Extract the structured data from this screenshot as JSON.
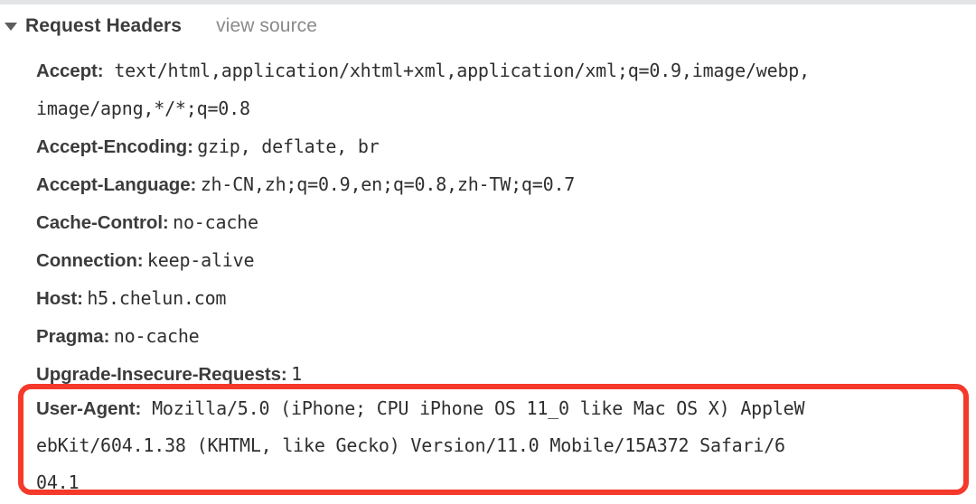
{
  "section": {
    "title": "Request Headers",
    "view_source_label": "view source",
    "disclosure_icon": "triangle-down-icon",
    "expanded": true
  },
  "colors": {
    "highlight_red": "#f5392a",
    "header_name_text": "#3c3c3c",
    "header_value_text": "#2f2f2f",
    "view_source_text": "#8a8a8a",
    "top_strip": "#e3e4e6",
    "background": "#ffffff"
  },
  "headers": [
    {
      "name": "Accept:",
      "value": "text/html,application/xhtml+xml,application/xml;q=0.9,image/webp,image/apng,*/*;q=0.8",
      "lines": [
        "text/html,application/xhtml+xml,application/xml;q=0.9,image/webp,",
        "image/apng,*/*;q=0.8"
      ],
      "highlighted": false
    },
    {
      "name": "Accept-Encoding:",
      "value": "gzip, deflate, br",
      "lines": [
        "gzip, deflate, br"
      ],
      "highlighted": false
    },
    {
      "name": "Accept-Language:",
      "value": "zh-CN,zh;q=0.9,en;q=0.8,zh-TW;q=0.7",
      "lines": [
        "zh-CN,zh;q=0.9,en;q=0.8,zh-TW;q=0.7"
      ],
      "highlighted": false
    },
    {
      "name": "Cache-Control:",
      "value": "no-cache",
      "lines": [
        "no-cache"
      ],
      "highlighted": false
    },
    {
      "name": "Connection:",
      "value": "keep-alive",
      "lines": [
        "keep-alive"
      ],
      "highlighted": false
    },
    {
      "name": "Host:",
      "value": "h5.chelun.com",
      "lines": [
        "h5.chelun.com"
      ],
      "highlighted": false
    },
    {
      "name": "Pragma:",
      "value": "no-cache",
      "lines": [
        "no-cache"
      ],
      "highlighted": false
    },
    {
      "name": "Upgrade-Insecure-Requests:",
      "value": "1",
      "lines": [
        "1"
      ],
      "highlighted": false
    },
    {
      "name": "User-Agent:",
      "value": "Mozilla/5.0 (iPhone; CPU iPhone OS 11_0 like Mac OS X) AppleWebKit/604.1.38 (KHTML, like Gecko) Version/11.0 Mobile/15A372 Safari/604.1",
      "lines": [
        "Mozilla/5.0 (iPhone; CPU iPhone OS 11_0 like Mac OS X) AppleW",
        "ebKit/604.1.38 (KHTML, like Gecko) Version/11.0 Mobile/15A372 Safari/6",
        "04.1"
      ],
      "highlighted": true
    }
  ],
  "rows": {
    "accept_name": "Accept:",
    "accept_line1": "text/html,application/xhtml+xml,application/xml;q=0.9,image/webp,",
    "accept_line2": "image/apng,*/*;q=0.8",
    "accept_encoding_name": "Accept-Encoding:",
    "accept_encoding_value": "gzip, deflate, br",
    "accept_language_name": "Accept-Language:",
    "accept_language_value": "zh-CN,zh;q=0.9,en;q=0.8,zh-TW;q=0.7",
    "cache_control_name": "Cache-Control:",
    "cache_control_value": "no-cache",
    "connection_name": "Connection:",
    "connection_value": "keep-alive",
    "host_name": "Host:",
    "host_value": "h5.chelun.com",
    "pragma_name": "Pragma:",
    "pragma_value": "no-cache",
    "upgrade_name": "Upgrade-Insecure-Requests:",
    "upgrade_value": "1",
    "user_agent_name": "User-Agent:",
    "user_agent_line1": "Mozilla/5.0 (iPhone; CPU iPhone OS 11_0 like Mac OS X) AppleW",
    "user_agent_line2": "ebKit/604.1.38 (KHTML, like Gecko) Version/11.0 Mobile/15A372 Safari/6",
    "user_agent_line3": "04.1"
  }
}
